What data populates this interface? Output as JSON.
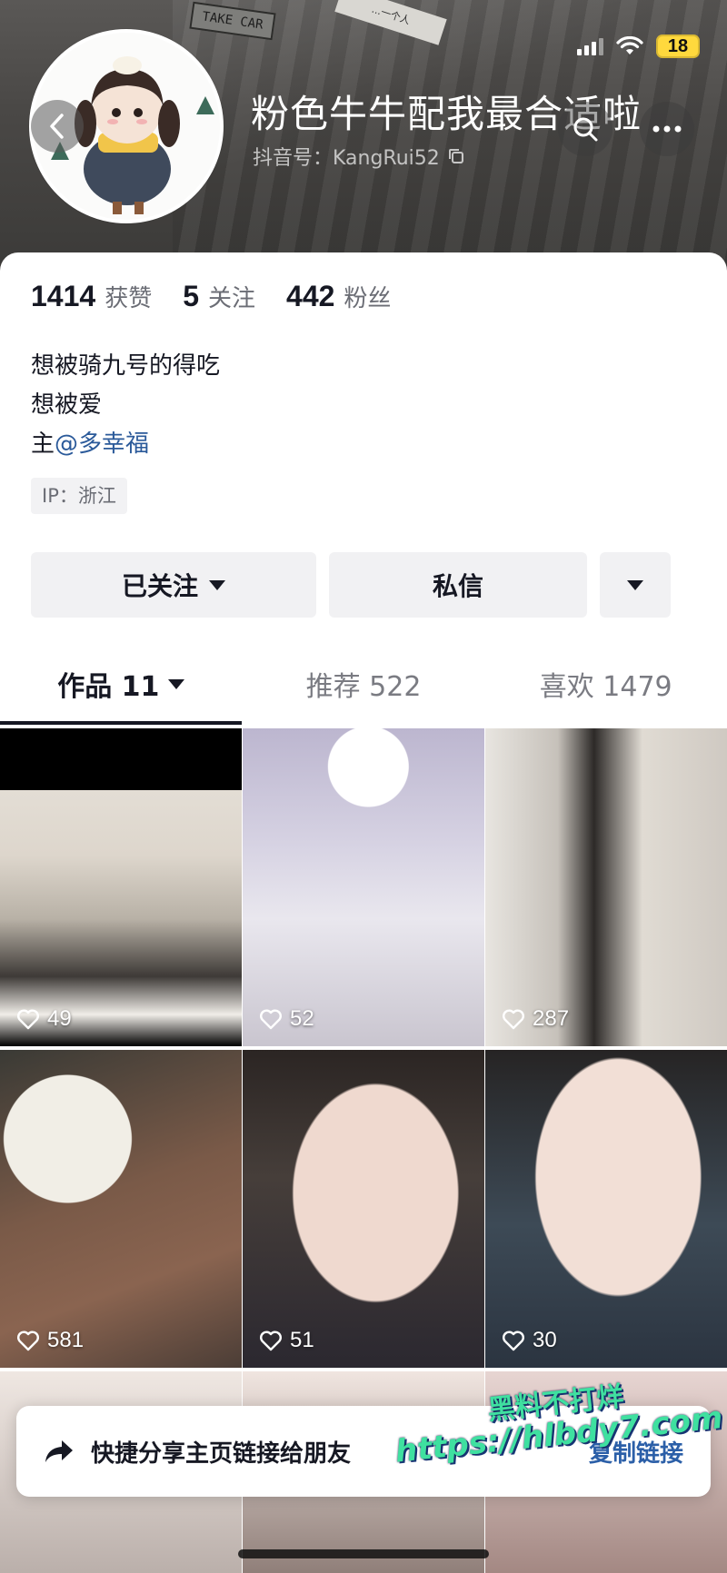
{
  "header": {
    "banner_sign": "TAKE CAR",
    "banner_plaque": "...一个人",
    "nickname": "粉色牛牛配我最合适啦",
    "douyin_id": "抖音号：KangRui52",
    "back_icon": "chevron-left-icon",
    "search_icon": "search-icon",
    "more_icon": "more-dots-icon"
  },
  "status_bar": {
    "battery": "18",
    "battery_color": "#ffd93d"
  },
  "stats": {
    "likes_num": "1414",
    "likes_label": "获赞",
    "following_num": "5",
    "following_label": "关注",
    "followers_num": "442",
    "followers_label": "粉丝"
  },
  "bio": {
    "line1": "想被骑九号的得吃",
    "line2": "想被爱",
    "line3_prefix": "主",
    "line3_mention": "@多幸福"
  },
  "ip_tag": "IP：浙江",
  "buttons": {
    "follow": "已关注",
    "message": "私信"
  },
  "tabs": {
    "works_label": "作品 11",
    "recommend_label": "推荐 522",
    "likes_label": "喜欢 1479"
  },
  "videos": [
    {
      "likes": "49"
    },
    {
      "likes": "52"
    },
    {
      "likes": "287"
    },
    {
      "likes": "581"
    },
    {
      "likes": "51"
    },
    {
      "likes": "30"
    }
  ],
  "share_banner": {
    "text": "快捷分享主页链接给朋友",
    "link": "复制链接"
  },
  "watermark": {
    "line1": "黑料不打烊",
    "line2": "https://hlbdy7.com"
  },
  "colors": {
    "accent_link": "#2b5a9a",
    "watermark": "#3fe0a0"
  }
}
